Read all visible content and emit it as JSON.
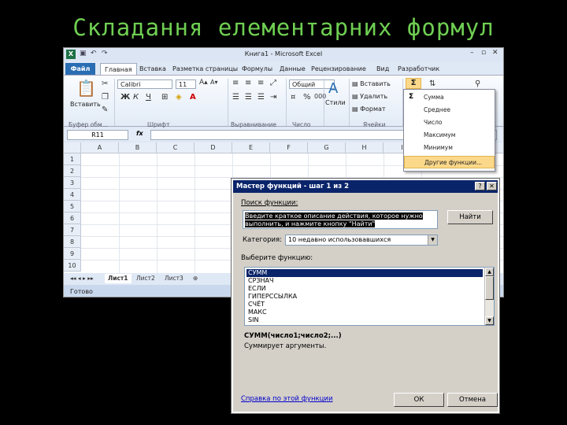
{
  "slide": {
    "title": "Складання елементарних формул"
  },
  "excel": {
    "window_title": "Книга1 - Microsoft Excel",
    "app_icon": "X",
    "tabs": [
      "Файл",
      "Главная",
      "Вставка",
      "Разметка страницы",
      "Формулы",
      "Данные",
      "Рецензирование",
      "Вид",
      "Разработчик"
    ],
    "ribbon": {
      "paste": "Вставить",
      "font": "Calibri",
      "size": "11",
      "number_format": "Общий",
      "styles": "Стили",
      "insert": "Вставить",
      "delete": "Удалить",
      "format": "Формат",
      "bold": "Ж",
      "italic": "К",
      "underline": "Ч",
      "groups": [
        "Буфер обм...",
        "Шрифт",
        "Выравнивание",
        "Число",
        "Ячейки"
      ]
    },
    "name_box": "R11",
    "fx": "fx",
    "columns": [
      "A",
      "B",
      "C",
      "D",
      "E",
      "F",
      "G",
      "H",
      "I"
    ],
    "rows": [
      "1",
      "2",
      "3",
      "4",
      "5",
      "6",
      "7",
      "8",
      "9",
      "10"
    ],
    "sheets": [
      "Лист1",
      "Лист2",
      "Лист3"
    ],
    "status": "Готово",
    "sum_menu": [
      "Сумма",
      "Среднее",
      "Число",
      "Максимум",
      "Минимум",
      "Другие функции..."
    ]
  },
  "dialog": {
    "title": "Мастер функций - шаг 1 из 2",
    "help": "?",
    "close": "✕",
    "search_label": "Поиск функции:",
    "search_text": "Введите краткое описание действия, которое нужно выполнить, и нажмите кнопку \"Найти\"",
    "find_button": "Найти",
    "category_label": "Категория:",
    "category_value": "10 недавно использовавшихся",
    "choose_label": "Выберите функцию:",
    "functions": [
      "СУММ",
      "СРЗНАЧ",
      "ЕСЛИ",
      "ГИПЕРССЫЛКА",
      "СЧЁТ",
      "МАКС",
      "SIN"
    ],
    "signature": "СУММ(число1;число2;...)",
    "description": "Суммирует аргументы.",
    "help_link": "Справка по этой функции",
    "ok": "ОК",
    "cancel": "Отмена"
  }
}
